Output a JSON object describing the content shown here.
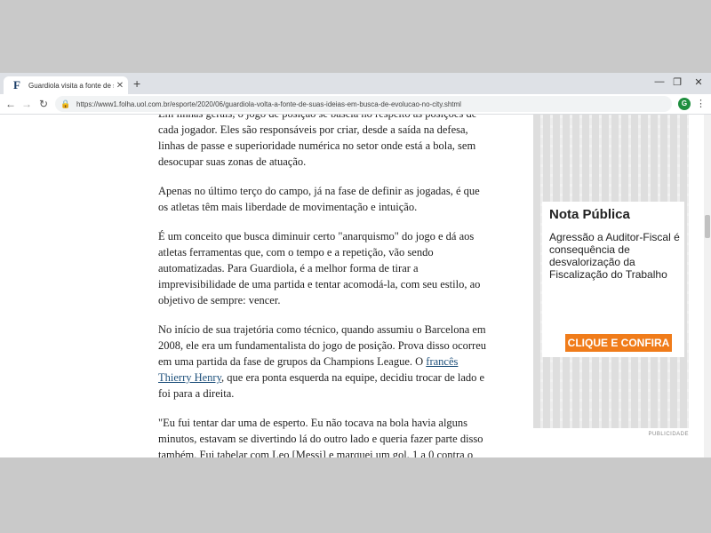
{
  "tab": {
    "title": "Guardiola visita a fonte de suas ideias",
    "favicon": "F"
  },
  "window_controls": {
    "minimize": "—",
    "restore": "❐",
    "close": "✕"
  },
  "toolbar": {
    "back": "←",
    "forward": "→",
    "reload": "↻",
    "url": "https://www1.folha.uol.com.br/esporte/2020/06/guardiola-volta-a-fonte-de-suas-ideias-em-busca-de-evolucao-no-city.shtml",
    "profile_initial": "G"
  },
  "article": {
    "p1": "Em linhas gerais, o jogo de posição se baseia no respeito às posições de cada jogador. Eles são responsáveis por criar, desde a saída na defesa, linhas de passe e superioridade numérica no setor onde está a bola, sem desocupar suas zonas de atuação.",
    "p2": "Apenas no último terço do campo, já na fase de definir as jogadas, é que os atletas têm mais liberdade de movimentação e intuição.",
    "p3": "É um conceito que busca diminuir certo \"anarquismo\" do jogo e dá aos atletas ferramentas que, com o tempo e a repetição, vão sendo automatizadas. Para Guardiola, é a melhor forma de tirar a imprevisibilidade de uma partida e tentar acomodá-la, com seu estilo, ao objetivo de sempre: vencer.",
    "p4_before": "No início de sua trajetória como técnico, quando assumiu o Barcelona em 2008, ele era um fundamentalista do jogo de posição. Prova disso ocorreu em uma partida da fase de grupos da Champions League. O ",
    "p4_link": "francês Thierry Henry",
    "p4_after": ", que era ponta esquerda na equipe, decidiu trocar de lado e foi para a direita.",
    "p5": "\"Eu fui tentar dar uma de esperto. Eu não tocava na bola havia alguns minutos, estavam se divertindo lá do outro lado e queria fazer parte disso também. Fui tabelar com Leo [Messi] e marquei um gol, 1 a 0 contra o Sporting. No intervalo, fui substituído. Quando Pep tem um"
  },
  "ad": {
    "heading": "Nota Pública",
    "body": "Agressão a Auditor-Fiscal é consequência de desvalorização da Fiscalização do Trabalho",
    "cta": "CLIQUE E CONFIRA",
    "label": "PUBLICIDADE"
  },
  "colors": {
    "cta": "#f07c1a",
    "link": "#1c4f7a",
    "favicon": "#1a3c66"
  }
}
